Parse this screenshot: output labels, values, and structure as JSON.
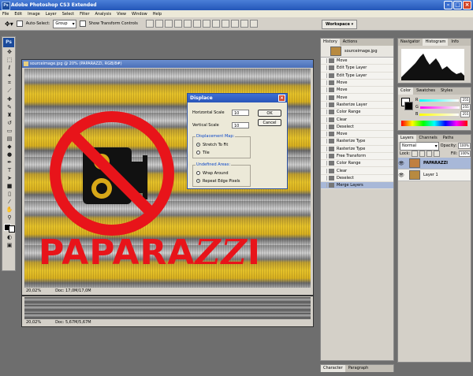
{
  "app": {
    "title": "Adobe Photoshop CS3 Extended",
    "logo": "Ps"
  },
  "menu": [
    "File",
    "Edit",
    "Image",
    "Layer",
    "Select",
    "Filter",
    "Analysis",
    "View",
    "Window",
    "Help"
  ],
  "options": {
    "auto_select_label": "Auto-Select:",
    "auto_select_value": "Group",
    "show_transform_label": "Show Transform Controls",
    "workspace_label": "Workspace ▾"
  },
  "document": {
    "title": "sourceimage.jpg @ 20% (PAPARAZZI, RGB/8#)",
    "zoom": "20,02%",
    "doc_size": "Doc: 17,0M/17,0M",
    "artwork_text_main": "PAPARA",
    "artwork_text_zz": "ZZ",
    "artwork_text_end": "I"
  },
  "document2": {
    "zoom": "20,02%",
    "doc_size": "Doc: 5,67M/5,67M"
  },
  "dialog": {
    "title": "Displace",
    "horizontal_label": "Horizontal Scale",
    "horizontal_value": "10",
    "vertical_label": "Vertical Scale",
    "vertical_value": "10",
    "ok_label": "OK",
    "cancel_label": "Cancel",
    "map_group": "Displacement Map:",
    "map_options": [
      "Stretch To Fit",
      "Tile"
    ],
    "map_selected": 0,
    "undefined_group": "Undefined Areas:",
    "undefined_options": [
      "Wrap Around",
      "Repeat Edge Pixels"
    ],
    "undefined_selected": 1
  },
  "history": {
    "tabs": [
      "History",
      "Actions"
    ],
    "snapshot": "sourceimage.jpg",
    "items": [
      "Move",
      "Edit Type Layer",
      "Edit Type Layer",
      "Move",
      "Move",
      "Move",
      "Rasterize Layer",
      "Color Range",
      "Clear",
      "Deselect",
      "Move",
      "Rasterize Type",
      "Rasterize Type",
      "Free Transform",
      "Color Range",
      "Clear",
      "Deselect",
      "Merge Layers"
    ],
    "active_index": 17
  },
  "navigator": {
    "tabs": [
      "Navigator",
      "Histogram",
      "Info"
    ]
  },
  "color": {
    "tabs": [
      "Color",
      "Swatches",
      "Styles"
    ],
    "channels": [
      {
        "label": "R",
        "value": "255"
      },
      {
        "label": "G",
        "value": "255"
      },
      {
        "label": "B",
        "value": "255"
      }
    ]
  },
  "layers": {
    "tabs": [
      "Layers",
      "Channels",
      "Paths"
    ],
    "blend_mode": "Normal",
    "opacity_label": "Opacity:",
    "opacity_value": "100%",
    "lock_label": "Lock:",
    "fill_label": "Fill:",
    "fill_value": "100%",
    "items": [
      "PAPARAZZI",
      "Layer 1"
    ],
    "active_index": 0
  },
  "bottom_tabs": [
    "Character",
    "Paragraph"
  ]
}
